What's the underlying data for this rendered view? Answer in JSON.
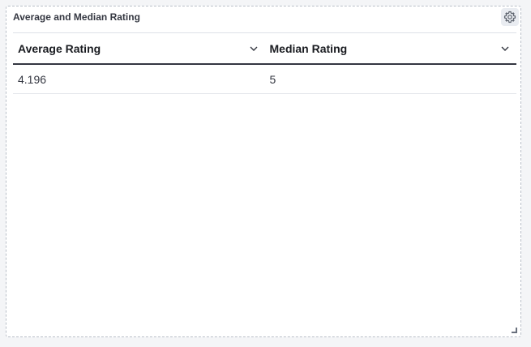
{
  "panel": {
    "title": "Average and Median Rating",
    "settings_icon": "gear-icon",
    "resize_icon": "resize-handle-icon"
  },
  "table": {
    "columns": [
      {
        "label": "Average Rating",
        "sort_icon": "chevron-down-icon"
      },
      {
        "label": "Median Rating",
        "sort_icon": "chevron-down-icon"
      }
    ],
    "rows": [
      [
        "4.196",
        "5"
      ]
    ]
  },
  "colors": {
    "header_rule": "#343741",
    "row_divider": "#e3e6eb",
    "panel_border": "#b9bfc8"
  }
}
